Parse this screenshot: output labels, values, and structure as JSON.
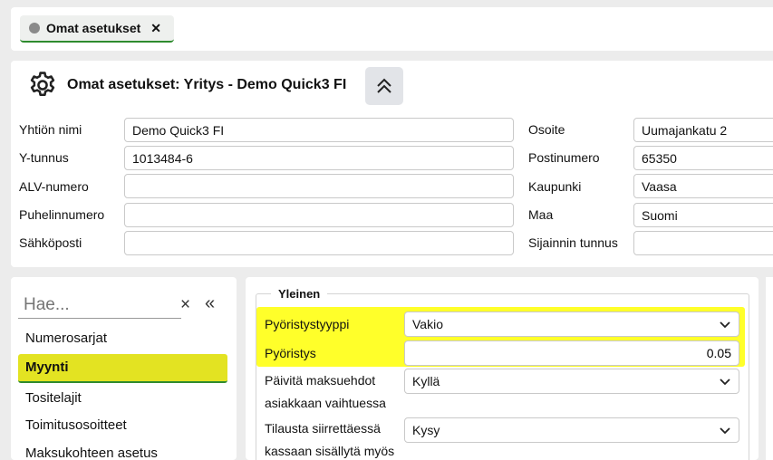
{
  "tab": {
    "label": "Omat asetukset",
    "close": "✕"
  },
  "header": {
    "title": "Omat asetukset: Yritys - Demo Quick3 FI"
  },
  "company": {
    "left": [
      {
        "label": "Yhtiön nimi",
        "value": "Demo Quick3 FI"
      },
      {
        "label": "Y-tunnus",
        "value": "1013484-6"
      },
      {
        "label": "ALV-numero",
        "value": ""
      },
      {
        "label": "Puhelinnumero",
        "value": ""
      },
      {
        "label": "Sähköposti",
        "value": ""
      }
    ],
    "right": [
      {
        "label": "Osoite",
        "value": "Uumajankatu 2"
      },
      {
        "label": "Postinumero",
        "value": "65350"
      },
      {
        "label": "Kaupunki",
        "value": "Vaasa"
      },
      {
        "label": "Maa",
        "value": "Suomi"
      },
      {
        "label": "Sijainnin tunnus",
        "value": ""
      }
    ]
  },
  "sidebar": {
    "search_placeholder": "Hae...",
    "clear": "×",
    "collapse": "«",
    "items": [
      "Numerosarjat",
      "Myynti",
      "Tositelajit",
      "Toimitusosoitteet",
      "Maksukohteen asetus"
    ]
  },
  "general": {
    "legend": "Yleinen",
    "rows": [
      {
        "label": "Pyöristystyyppi",
        "value": "Vakio"
      },
      {
        "label": "Pyöristys",
        "value": "0.05"
      },
      {
        "label_line1": "Päivitä maksuehdot",
        "label_line2": "asiakkaan vaihtuessa",
        "value": "Kyllä"
      },
      {
        "label_line1": "Tilausta siirrettäessä",
        "label_line2": "kassaan sisällytä myös",
        "value": "Kysy"
      }
    ]
  },
  "colors": {
    "accent": "#2e8b2e",
    "highlight": "#ffff2a",
    "active_nav": "#e3e322"
  }
}
